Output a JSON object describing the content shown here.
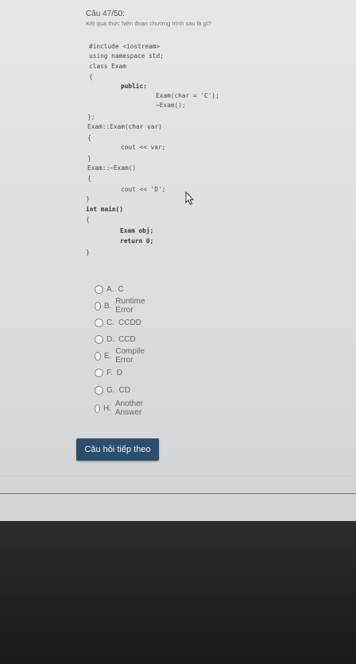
{
  "question": {
    "number": "Câu 47/50:",
    "prompt": "Kết quả thực hiện đoạn chương trình sau là gì?"
  },
  "code_lines": [
    "#include <iostream>",
    "using namespace std;",
    "class Exam",
    "{",
    "public:",
    "Exam(char = 'C');",
    "~Exam();",
    "};",
    "Exam::Exam(char var)",
    "{",
    "cout << var;",
    "}",
    "Exam::~Exam()",
    "{",
    "cout << 'D';",
    "}",
    "int main()",
    "{",
    "Exam obj;",
    "return 0;",
    "}"
  ],
  "options": [
    {
      "letter": "A.",
      "text": "C"
    },
    {
      "letter": "B.",
      "text": "Runtime Error"
    },
    {
      "letter": "C.",
      "text": "CCDD"
    },
    {
      "letter": "D.",
      "text": "CCD"
    },
    {
      "letter": "E.",
      "text": "Compile Error"
    },
    {
      "letter": "F.",
      "text": "D"
    },
    {
      "letter": "G.",
      "text": "CD"
    },
    {
      "letter": "H.",
      "text": "Another Answer"
    }
  ],
  "next_button": {
    "label": "Câu hỏi tiếp theo"
  },
  "colors": {
    "button_bg": "#2c4e6d",
    "page_bg": "#e3e4e5",
    "accent_line": "#b35a55"
  }
}
